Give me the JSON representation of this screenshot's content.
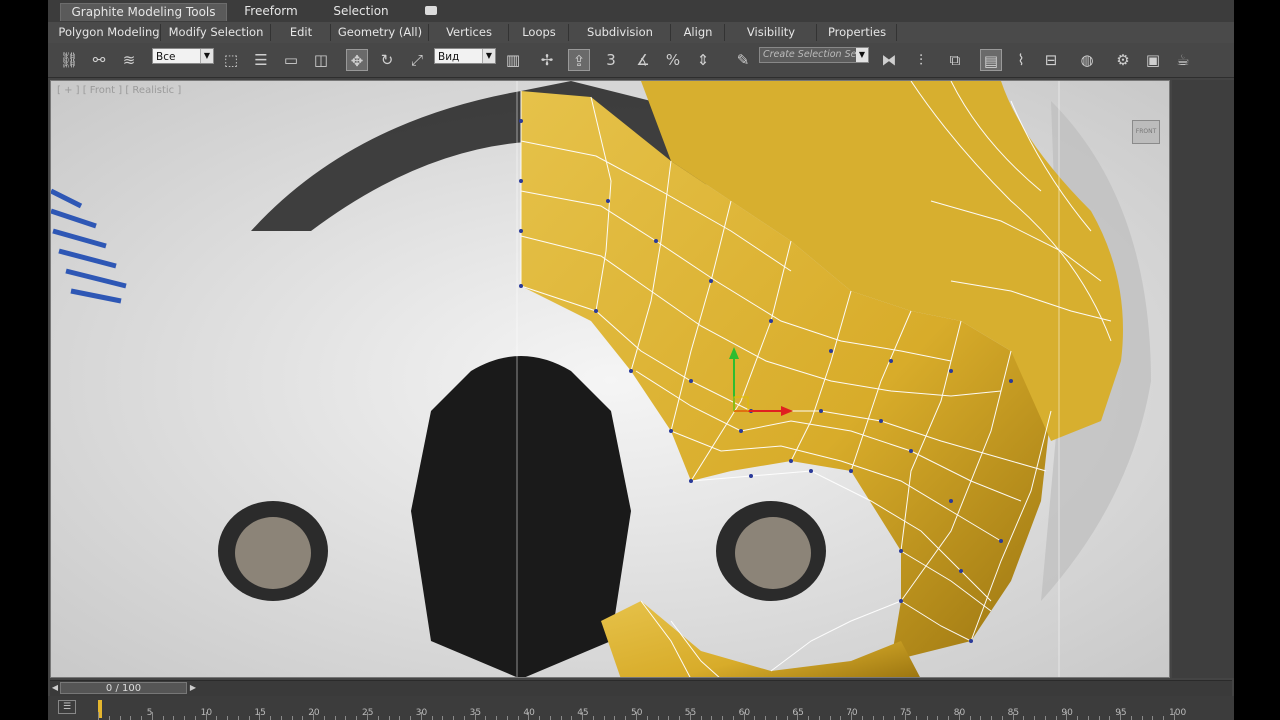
{
  "ribbon": {
    "tabs": [
      {
        "label": "Graphite Modeling Tools",
        "active": true
      },
      {
        "label": "Freeform",
        "active": false
      },
      {
        "label": "Selection",
        "active": false
      }
    ]
  },
  "panels": [
    {
      "label": "Polygon Modeling"
    },
    {
      "label": "Modify Selection"
    },
    {
      "label": "Edit"
    },
    {
      "label": "Geometry (All)"
    },
    {
      "label": "Vertices"
    },
    {
      "label": "Loops"
    },
    {
      "label": "Subdivision"
    },
    {
      "label": "Align"
    },
    {
      "label": "Visibility"
    },
    {
      "label": "Properties"
    }
  ],
  "toolbar": {
    "selection_filter": "Все",
    "reference_coord": "Вид",
    "named_selection_set": "Create Selection Se",
    "snap_toggle_label": "3",
    "icons": [
      "select-link-icon",
      "unlink-icon",
      "bind-spacewarp-icon",
      "select-object-icon",
      "select-by-name-icon",
      "rect-region-icon",
      "window-crossing-icon",
      "select-move-icon",
      "select-rotate-icon",
      "select-scale-icon",
      "pivot-center-icon",
      "manipulate-icon",
      "keyboard-shortcut-icon",
      "snaps-toggle-icon",
      "angle-snap-icon",
      "percent-snap-icon",
      "spinner-snap-icon",
      "edit-named-sets-icon",
      "mirror-icon",
      "align-icon",
      "layer-manager-icon",
      "graphite-toggle-icon",
      "curve-editor-icon",
      "schematic-view-icon",
      "material-editor-icon",
      "render-setup-icon",
      "render-frame-icon",
      "render-icon"
    ]
  },
  "viewport": {
    "label": "[ + ] [ Front ] [ Realistic ]",
    "viewcube_label": "FRONT"
  },
  "time_slider": {
    "current": 0,
    "total": 100,
    "label": "0 / 100"
  },
  "track_bar": {
    "ticks": [
      5,
      10,
      15,
      20,
      25,
      30,
      35,
      40,
      45,
      50,
      55,
      60,
      65,
      70,
      75,
      80,
      85,
      90,
      95,
      100
    ]
  },
  "colors": {
    "mesh_fill": "#d9b230",
    "mesh_wire": "#ffffff",
    "helmet": "#e9e9e9",
    "ui_bg": "#444444",
    "accent_frame": "#e5b62e"
  }
}
